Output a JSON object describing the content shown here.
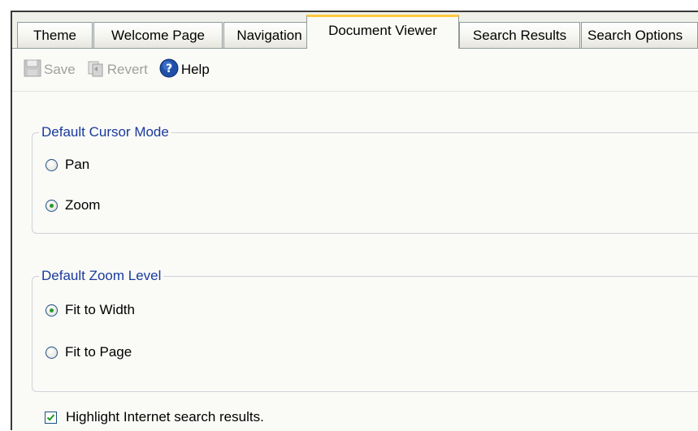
{
  "tabs": [
    {
      "label": "Theme",
      "active": false
    },
    {
      "label": "Welcome Page",
      "active": false
    },
    {
      "label": "Navigation",
      "active": false
    },
    {
      "label": "Document Viewer",
      "active": true
    },
    {
      "label": "Search Results",
      "active": false
    },
    {
      "label": "Search Options",
      "active": false
    }
  ],
  "toolbar": {
    "save_label": "Save",
    "revert_label": "Revert",
    "help_label": "Help",
    "save_icon": "floppy-disk-icon",
    "revert_icon": "revert-icon",
    "help_icon": "help-icon"
  },
  "cursor_mode": {
    "legend": "Default Cursor Mode",
    "options": [
      {
        "label": "Pan",
        "checked": false
      },
      {
        "label": "Zoom",
        "checked": true
      }
    ]
  },
  "zoom_level": {
    "legend": "Default Zoom Level",
    "options": [
      {
        "label": "Fit to Width",
        "checked": true
      },
      {
        "label": "Fit to Page",
        "checked": false
      }
    ]
  },
  "highlight": {
    "label": "Highlight Internet search results.",
    "checked": true
  },
  "colors": {
    "accent_tab": "#ffc83d",
    "legend_text": "#1a3b9c",
    "radio_dot": "#2a9a2a"
  }
}
